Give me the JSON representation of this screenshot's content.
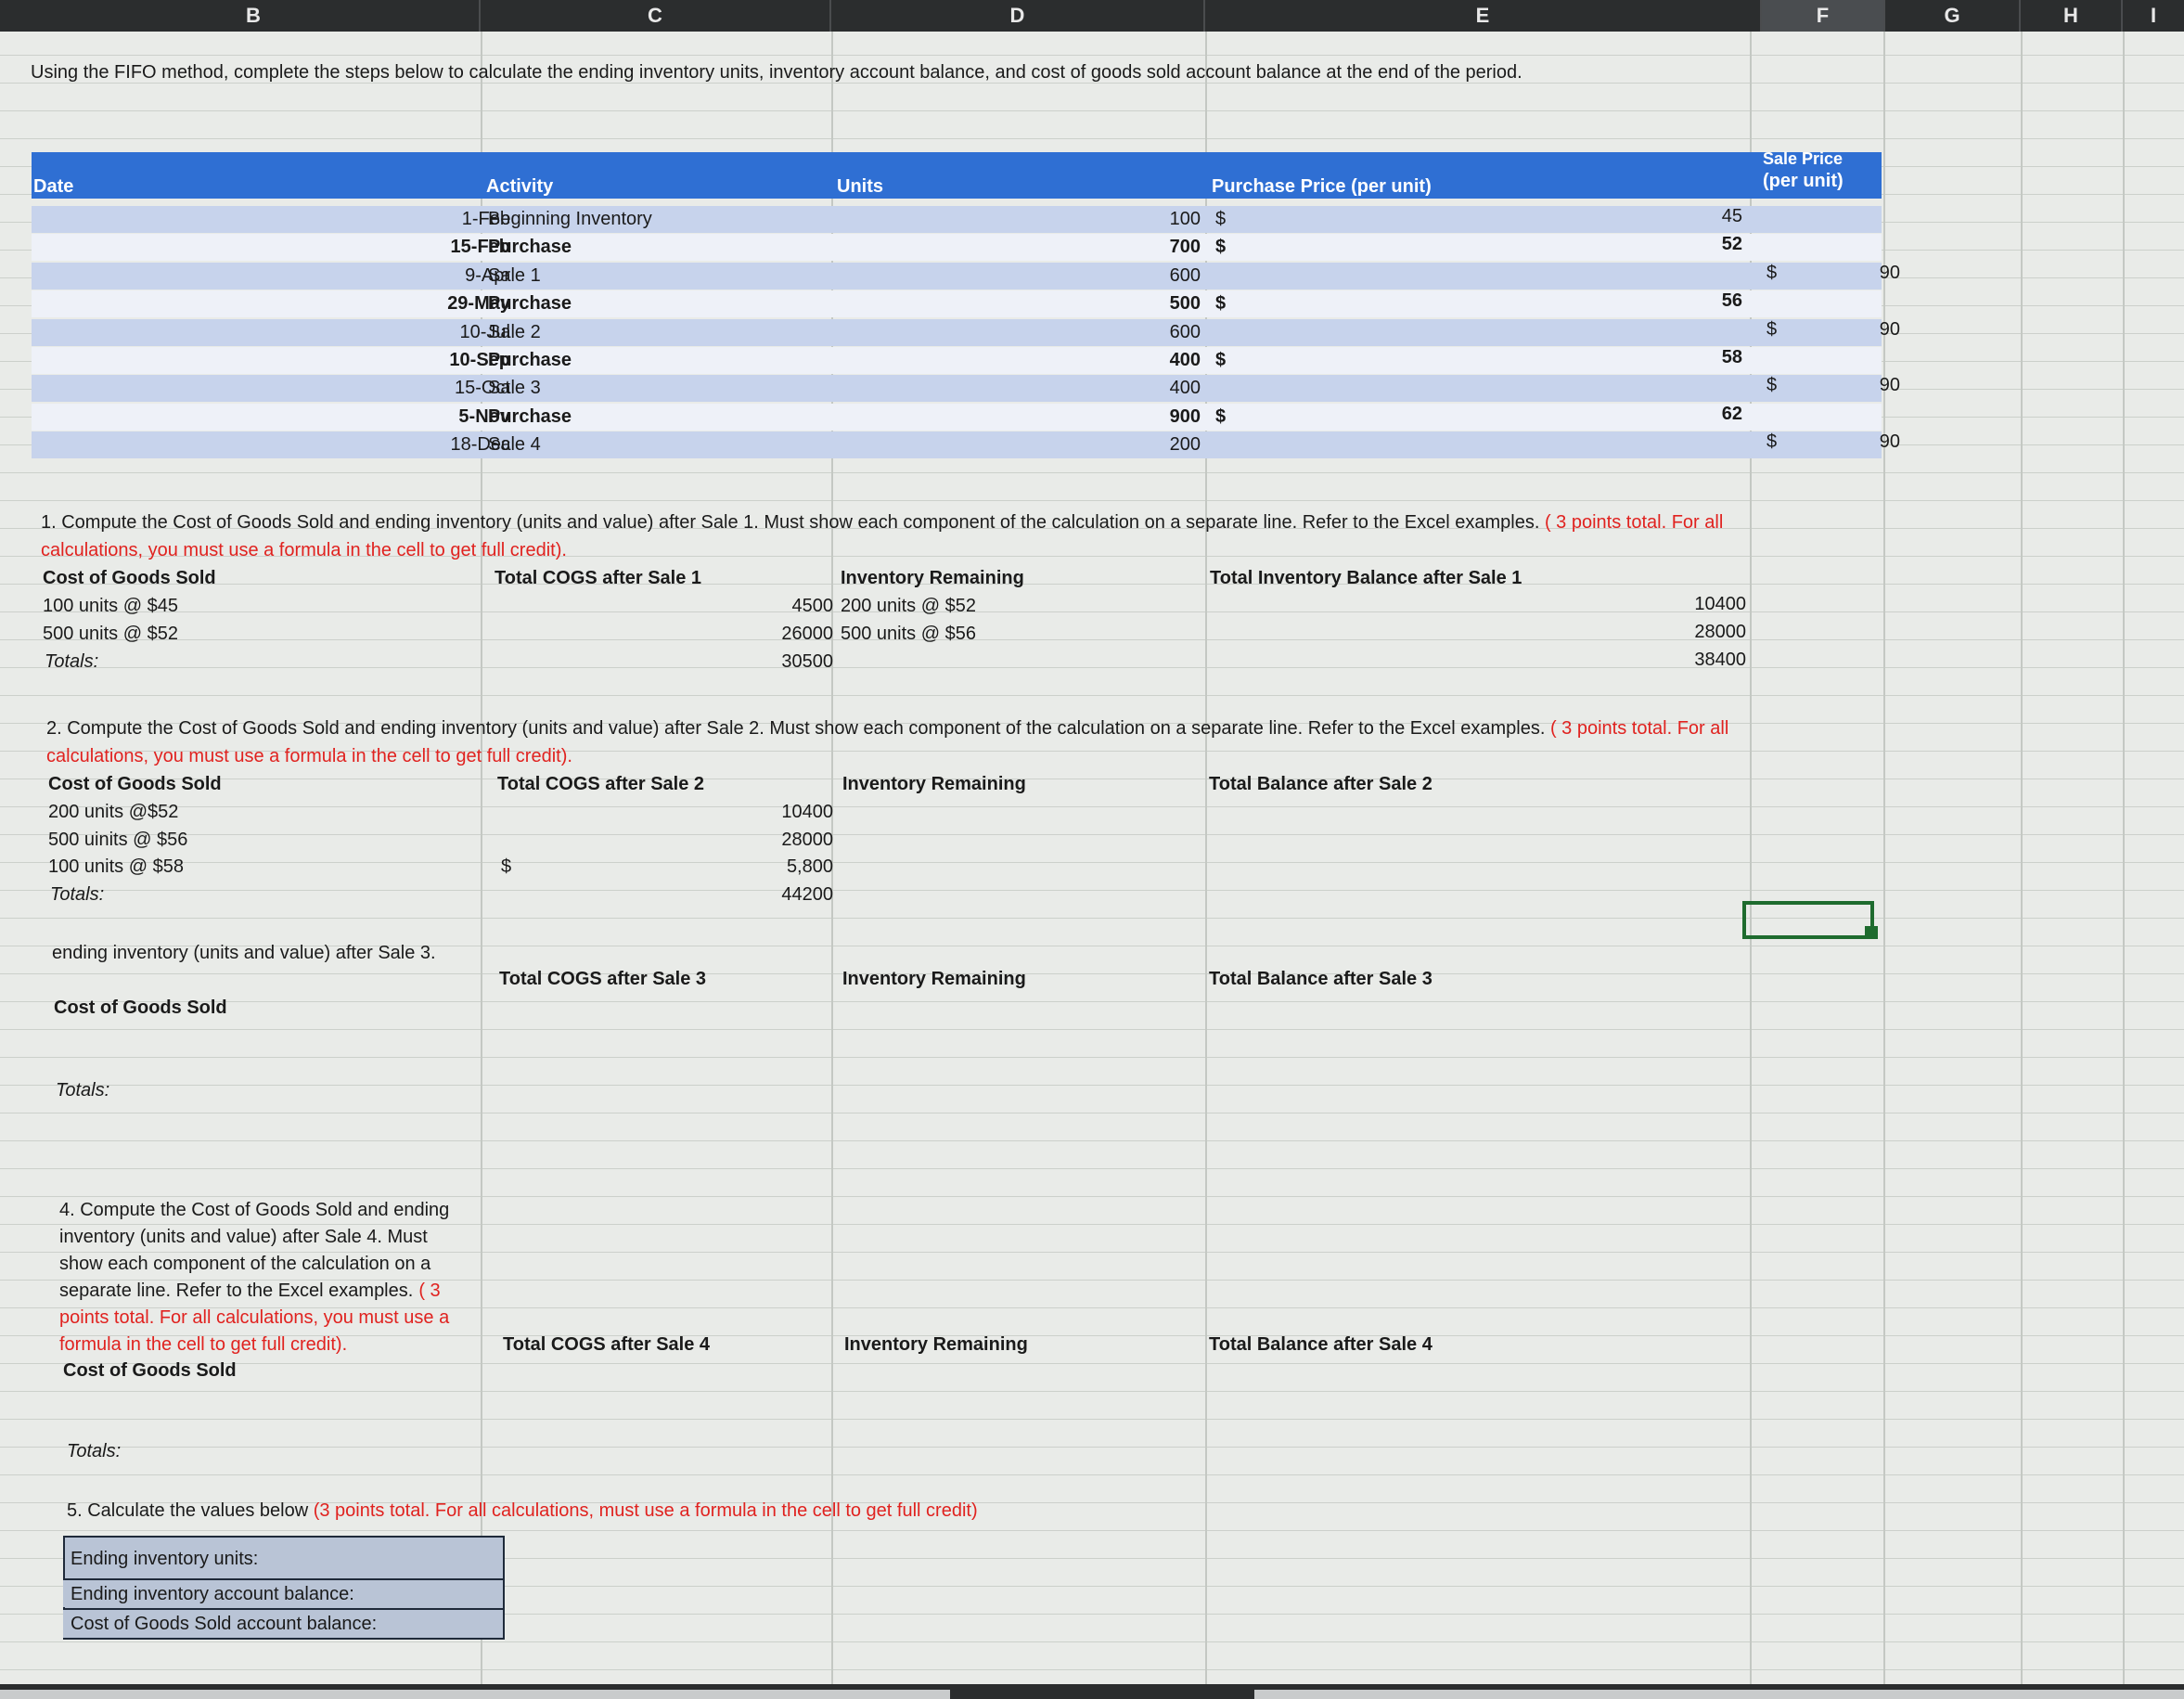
{
  "columns": [
    "B",
    "C",
    "D",
    "E",
    "F",
    "G",
    "H",
    "I"
  ],
  "instructions": "Using the FIFO method, complete the steps below to calculate the ending inventory units, inventory account balance, and cost of goods sold account balance at the end of the period.",
  "table": {
    "headers": {
      "date": "Date",
      "activity": "Activity",
      "units": "Units",
      "purchase_price": "Purchase Price (per unit)",
      "sale_price_line1": "Sale Price",
      "sale_price_line2": "(per unit)"
    },
    "rows": [
      {
        "date": "1-Feb",
        "activity": "Beginning Inventory",
        "units": "100",
        "currency": "$",
        "purchase_price": "45",
        "sale_currency": "",
        "sale_price": ""
      },
      {
        "date": "15-Feb",
        "activity": "Purchase",
        "units": "700",
        "currency": "$",
        "purchase_price": "52",
        "sale_currency": "",
        "sale_price": ""
      },
      {
        "date": "9-Apr",
        "activity": "Sale 1",
        "units": "600",
        "currency": "",
        "purchase_price": "",
        "sale_currency": "$",
        "sale_price": "90"
      },
      {
        "date": "29-May",
        "activity": "Purchase",
        "units": "500",
        "currency": "$",
        "purchase_price": "56",
        "sale_currency": "",
        "sale_price": ""
      },
      {
        "date": "10-Jul",
        "activity": "Sale 2",
        "units": "600",
        "currency": "",
        "purchase_price": "",
        "sale_currency": "$",
        "sale_price": "90"
      },
      {
        "date": "10-Sep",
        "activity": "Purchase",
        "units": "400",
        "currency": "$",
        "purchase_price": "58",
        "sale_currency": "",
        "sale_price": ""
      },
      {
        "date": "15-Oct",
        "activity": "Sale 3",
        "units": "400",
        "currency": "",
        "purchase_price": "",
        "sale_currency": "$",
        "sale_price": "90"
      },
      {
        "date": "5-Nov",
        "activity": "Purchase",
        "units": "900",
        "currency": "$",
        "purchase_price": "62",
        "sale_currency": "",
        "sale_price": ""
      },
      {
        "date": "18-Dec",
        "activity": "Sale 4",
        "units": "200",
        "currency": "",
        "purchase_price": "",
        "sale_currency": "$",
        "sale_price": "90"
      }
    ]
  },
  "q1": {
    "prompt": "1.  Compute the Cost of Goods Sold and ending inventory (units and value) after Sale 1.  Must show each component of the calculation on a separate line.  Refer to the Excel examples.",
    "prompt_red": "( 3 points total.  For all",
    "prompt_red2": "calculations, you must use a formula in the cell to get full credit).",
    "h_cogs": "Cost of Goods Sold",
    "h_total": "Total COGS after Sale 1",
    "h_inv": "Inventory Remaining",
    "h_bal": "Total Inventory Balance after Sale 1",
    "rows": [
      {
        "cogs": "100 units @ $45",
        "total": "4500",
        "inv": "200 units @ $52",
        "bal": "10400"
      },
      {
        "cogs": "500 units @ $52",
        "total": "26000",
        "inv": "500 units @ $56",
        "bal": "28000"
      }
    ],
    "totals_label": "Totals:",
    "totals_value": "30500",
    "bal_total": "38400"
  },
  "q2": {
    "prompt": "2.  Compute the Cost of Goods Sold and ending inventory (units and value) after Sale 2.  Must show each component of the calculation on a separate line.  Refer to the Excel examples.",
    "prompt_red": "( 3 points total.  For all",
    "prompt_red2": "calculations, you must use a formula in the cell to get full credit).",
    "h_cogs": "Cost of Goods Sold",
    "h_total": "Total COGS after Sale 2",
    "h_inv": "Inventory Remaining",
    "h_bal": "Total Balance after Sale 2",
    "rows": [
      {
        "cogs": "200 units @$52",
        "prefix": "",
        "total": "10400"
      },
      {
        "cogs": "500 uinits @ $56",
        "prefix": "",
        "total": "28000"
      },
      {
        "cogs": "100 units @ $58",
        "prefix": "$",
        "total": "5,800"
      }
    ],
    "totals_label": "Totals:",
    "totals_value": "44200"
  },
  "q3": {
    "prompt": "ending inventory (units and value) after Sale 3.",
    "h_cogs": "Cost of Goods Sold",
    "h_total": "Total COGS after Sale 3",
    "h_inv": "Inventory Remaining",
    "h_bal": "Total Balance after Sale 3",
    "totals_label": "Totals:"
  },
  "q4": {
    "prompt_lines": [
      "4.  Compute the Cost of Goods Sold and ending",
      "inventory (units and value) after Sale 4.  Must",
      "show each component of the calculation on a",
      "separate line.  Refer to the Excel examples."
    ],
    "red_lines": [
      "( 3",
      "points total.  For all calculations, you must use a",
      "formula in the cell to get full credit)."
    ],
    "h_cogs": "Cost of Goods Sold",
    "h_total": "Total COGS after Sale 4",
    "h_inv": "Inventory Remaining",
    "h_bal": "Total Balance after Sale 4",
    "totals_label": "Totals:"
  },
  "q5": {
    "prompt": "5.  Calculate the values below",
    "prompt_red": "(3 points total.  For all calculations, must use a formula in the cell to get full credit)",
    "items": [
      "Ending inventory units:",
      "Ending inventory account balance:",
      "Cost of Goods Sold account balance:"
    ]
  }
}
